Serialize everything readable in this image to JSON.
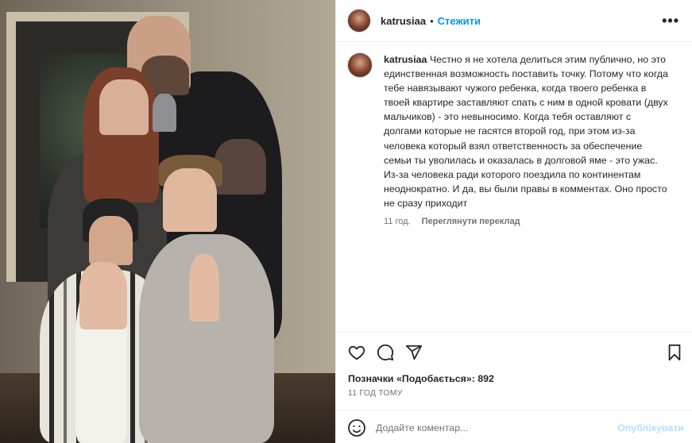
{
  "post": {
    "image_alt": "Family photo",
    "header": {
      "username": "katrusiaa",
      "separator": "•",
      "follow_label": "Стежити",
      "more_label": "•••"
    },
    "caption": {
      "username": "katrusiaa",
      "text": "Честно я не хотела делиться этим публично, но это единственная возможность поставить точку. Потому что когда тебе навязывают чужого ребенка, когда твоего ребенка в твоей квартире заставляют спать с ним в одной кровати (двух мальчиков) - это невыносимо. Когда тебя оставляют с долгами которые не гасятся второй год, при этом из-за человека который взял ответственность за обеспечение семьи ты уволилась и оказалась в долговой яме - это ужас. Из-за человека ради которого поездила по континентам неоднократно. И да, вы были правы в комментах. Оно просто не сразу приходит",
      "age": "11 год.",
      "translate_label": "Переглянути переклад"
    },
    "actions": {
      "like_icon": "heart-icon",
      "comment_icon": "comment-icon",
      "share_icon": "share-icon",
      "save_icon": "bookmark-icon"
    },
    "likes_text": "Позначки «Подобається»: 892",
    "timestamp": "11 ГОД ТОМУ",
    "comment_box": {
      "placeholder": "Додайте коментар...",
      "publish_label": "Опублікувати",
      "emoji_icon": "smiley-icon"
    }
  },
  "colors": {
    "accent": "#0095f6",
    "publish_disabled": "#b2dffc",
    "text": "#262626",
    "muted": "#737373"
  }
}
